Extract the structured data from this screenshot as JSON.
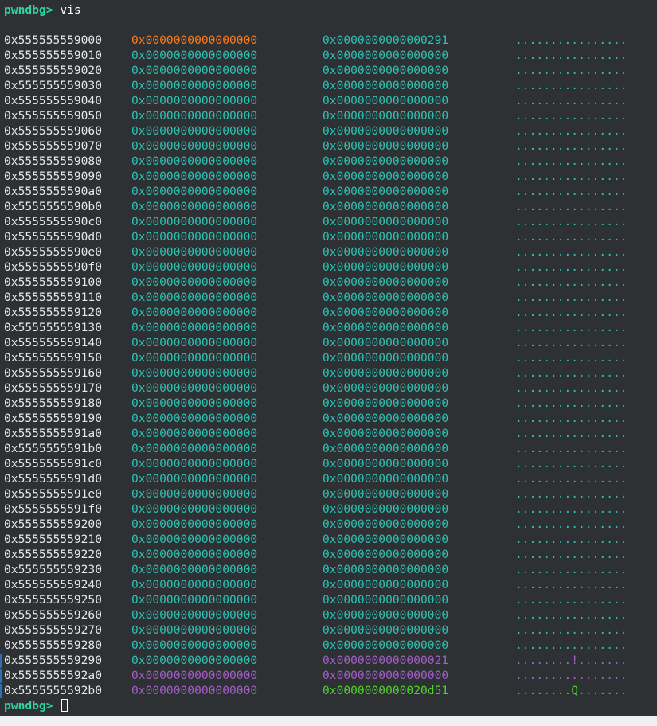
{
  "prompt": "pwndbg>",
  "command": "vis",
  "rows": [
    {
      "addr": "0x555555559000",
      "q1": "0x0000000000000000",
      "q2": "0x0000000000000291",
      "ascii": "................",
      "q1_color": "#ff7a1a",
      "q2_color": "#2fc1b3",
      "ascii_color": "#2fc1b3"
    },
    {
      "addr": "0x555555559010",
      "q1": "0x0000000000000000",
      "q2": "0x0000000000000000",
      "ascii": "................"
    },
    {
      "addr": "0x555555559020",
      "q1": "0x0000000000000000",
      "q2": "0x0000000000000000",
      "ascii": "................"
    },
    {
      "addr": "0x555555559030",
      "q1": "0x0000000000000000",
      "q2": "0x0000000000000000",
      "ascii": "................"
    },
    {
      "addr": "0x555555559040",
      "q1": "0x0000000000000000",
      "q2": "0x0000000000000000",
      "ascii": "................"
    },
    {
      "addr": "0x555555559050",
      "q1": "0x0000000000000000",
      "q2": "0x0000000000000000",
      "ascii": "................"
    },
    {
      "addr": "0x555555559060",
      "q1": "0x0000000000000000",
      "q2": "0x0000000000000000",
      "ascii": "................"
    },
    {
      "addr": "0x555555559070",
      "q1": "0x0000000000000000",
      "q2": "0x0000000000000000",
      "ascii": "................"
    },
    {
      "addr": "0x555555559080",
      "q1": "0x0000000000000000",
      "q2": "0x0000000000000000",
      "ascii": "................"
    },
    {
      "addr": "0x555555559090",
      "q1": "0x0000000000000000",
      "q2": "0x0000000000000000",
      "ascii": "................"
    },
    {
      "addr": "0x5555555590a0",
      "q1": "0x0000000000000000",
      "q2": "0x0000000000000000",
      "ascii": "................"
    },
    {
      "addr": "0x5555555590b0",
      "q1": "0x0000000000000000",
      "q2": "0x0000000000000000",
      "ascii": "................"
    },
    {
      "addr": "0x5555555590c0",
      "q1": "0x0000000000000000",
      "q2": "0x0000000000000000",
      "ascii": "................"
    },
    {
      "addr": "0x5555555590d0",
      "q1": "0x0000000000000000",
      "q2": "0x0000000000000000",
      "ascii": "................"
    },
    {
      "addr": "0x5555555590e0",
      "q1": "0x0000000000000000",
      "q2": "0x0000000000000000",
      "ascii": "................"
    },
    {
      "addr": "0x5555555590f0",
      "q1": "0x0000000000000000",
      "q2": "0x0000000000000000",
      "ascii": "................"
    },
    {
      "addr": "0x555555559100",
      "q1": "0x0000000000000000",
      "q2": "0x0000000000000000",
      "ascii": "................"
    },
    {
      "addr": "0x555555559110",
      "q1": "0x0000000000000000",
      "q2": "0x0000000000000000",
      "ascii": "................"
    },
    {
      "addr": "0x555555559120",
      "q1": "0x0000000000000000",
      "q2": "0x0000000000000000",
      "ascii": "................"
    },
    {
      "addr": "0x555555559130",
      "q1": "0x0000000000000000",
      "q2": "0x0000000000000000",
      "ascii": "................"
    },
    {
      "addr": "0x555555559140",
      "q1": "0x0000000000000000",
      "q2": "0x0000000000000000",
      "ascii": "................"
    },
    {
      "addr": "0x555555559150",
      "q1": "0x0000000000000000",
      "q2": "0x0000000000000000",
      "ascii": "................"
    },
    {
      "addr": "0x555555559160",
      "q1": "0x0000000000000000",
      "q2": "0x0000000000000000",
      "ascii": "................"
    },
    {
      "addr": "0x555555559170",
      "q1": "0x0000000000000000",
      "q2": "0x0000000000000000",
      "ascii": "................"
    },
    {
      "addr": "0x555555559180",
      "q1": "0x0000000000000000",
      "q2": "0x0000000000000000",
      "ascii": "................"
    },
    {
      "addr": "0x555555559190",
      "q1": "0x0000000000000000",
      "q2": "0x0000000000000000",
      "ascii": "................"
    },
    {
      "addr": "0x5555555591a0",
      "q1": "0x0000000000000000",
      "q2": "0x0000000000000000",
      "ascii": "................"
    },
    {
      "addr": "0x5555555591b0",
      "q1": "0x0000000000000000",
      "q2": "0x0000000000000000",
      "ascii": "................"
    },
    {
      "addr": "0x5555555591c0",
      "q1": "0x0000000000000000",
      "q2": "0x0000000000000000",
      "ascii": "................"
    },
    {
      "addr": "0x5555555591d0",
      "q1": "0x0000000000000000",
      "q2": "0x0000000000000000",
      "ascii": "................"
    },
    {
      "addr": "0x5555555591e0",
      "q1": "0x0000000000000000",
      "q2": "0x0000000000000000",
      "ascii": "................"
    },
    {
      "addr": "0x5555555591f0",
      "q1": "0x0000000000000000",
      "q2": "0x0000000000000000",
      "ascii": "................"
    },
    {
      "addr": "0x555555559200",
      "q1": "0x0000000000000000",
      "q2": "0x0000000000000000",
      "ascii": "................"
    },
    {
      "addr": "0x555555559210",
      "q1": "0x0000000000000000",
      "q2": "0x0000000000000000",
      "ascii": "................"
    },
    {
      "addr": "0x555555559220",
      "q1": "0x0000000000000000",
      "q2": "0x0000000000000000",
      "ascii": "................"
    },
    {
      "addr": "0x555555559230",
      "q1": "0x0000000000000000",
      "q2": "0x0000000000000000",
      "ascii": "................"
    },
    {
      "addr": "0x555555559240",
      "q1": "0x0000000000000000",
      "q2": "0x0000000000000000",
      "ascii": "................"
    },
    {
      "addr": "0x555555559250",
      "q1": "0x0000000000000000",
      "q2": "0x0000000000000000",
      "ascii": "................"
    },
    {
      "addr": "0x555555559260",
      "q1": "0x0000000000000000",
      "q2": "0x0000000000000000",
      "ascii": "................"
    },
    {
      "addr": "0x555555559270",
      "q1": "0x0000000000000000",
      "q2": "0x0000000000000000",
      "ascii": "................"
    },
    {
      "addr": "0x555555559280",
      "q1": "0x0000000000000000",
      "q2": "0x0000000000000000",
      "ascii": "................"
    },
    {
      "addr": "0x555555559290",
      "q1": "0x0000000000000000",
      "q2": "0x0000000000000021",
      "ascii": "........!.......",
      "q1_color": "#2fc1b3",
      "q2_color": "#a45ec8",
      "ascii_color": "#a45ec8",
      "marker": true
    },
    {
      "addr": "0x5555555592a0",
      "q1": "0x0000000000000000",
      "q2": "0x0000000000000000",
      "ascii": "................",
      "q1_color": "#a45ec8",
      "q2_color": "#a45ec8",
      "ascii_color": "#a45ec8",
      "marker": true
    },
    {
      "addr": "0x5555555592b0",
      "q1": "0x0000000000000000",
      "q2": "0x0000000000020d51",
      "ascii": "........Q.......",
      "q1_color": "#a45ec8",
      "q2_color": "#4fd12c",
      "ascii_color": "#4fd12c",
      "marker": true
    }
  ],
  "default_colors": {
    "addr": "#e8e8e8",
    "quad": "#2fc1b3",
    "ascii": "#2fc1b3",
    "prompt": "#2fd39b",
    "background": "#2d3134"
  }
}
